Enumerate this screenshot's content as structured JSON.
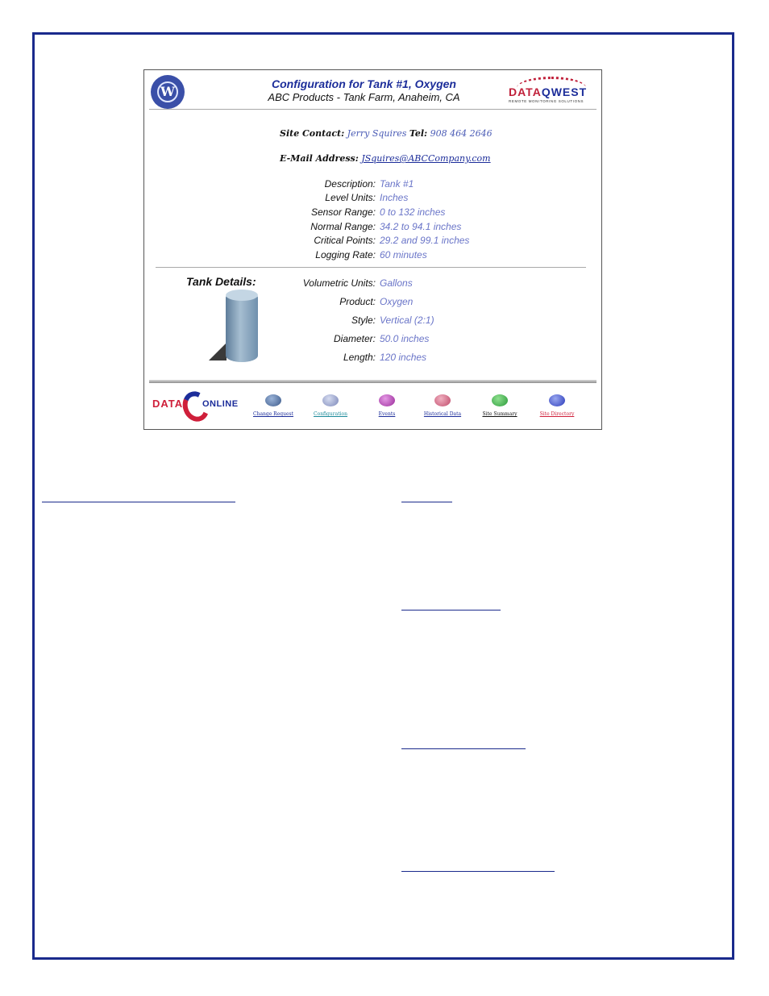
{
  "header": {
    "logo_text": "W",
    "title": "Configuration for Tank #1, Oxygen",
    "subtitle": "ABC Products - Tank Farm, Anaheim, CA",
    "brand_logo": {
      "text_red": "DATA",
      "text_blue": "QWEST",
      "tagline": "REMOTE MONITORING SOLUTIONS"
    }
  },
  "contact": {
    "site_contact_label": "Site Contact:",
    "site_contact_value": "Jerry Squires",
    "tel_label": "Tel:",
    "tel_value": "908 464 2646",
    "email_label": "E-Mail Address:",
    "email_value": "JSquires@ABCCompany.com"
  },
  "config_fields": [
    {
      "label": "Description:",
      "value": "Tank #1"
    },
    {
      "label": "Level Units:",
      "value": "Inches"
    },
    {
      "label": "Sensor Range:",
      "value": "0 to 132 inches"
    },
    {
      "label": "Normal Range:",
      "value": "34.2 to 94.1 inches"
    },
    {
      "label": "Critical Points:",
      "value": "29.2 and 99.1 inches"
    },
    {
      "label": "Logging Rate:",
      "value": "60 minutes"
    }
  ],
  "tank_details": {
    "heading": "Tank Details:",
    "fields": [
      {
        "label": "Volumetric Units:",
        "value": "Gallons"
      },
      {
        "label": "Product:",
        "value": "Oxygen"
      },
      {
        "label": "Style:",
        "value": "Vertical (2:1)"
      },
      {
        "label": "Diameter:",
        "value": "50.0 inches"
      },
      {
        "label": "Length:",
        "value": "120 inches"
      }
    ]
  },
  "nav": {
    "brand": {
      "part1": "DATA",
      "part2": "ONLINE"
    },
    "items": [
      {
        "label": "Change Request",
        "icon": "globe-icon",
        "color": "#3c5a8a",
        "text_color": "#1c2d9a"
      },
      {
        "label": "Configuration",
        "icon": "gear-globe-icon",
        "color": "#7a86b8",
        "text_color": "#1c8a9a"
      },
      {
        "label": "Events",
        "icon": "star-icon",
        "color": "#9a2a9a",
        "text_color": "#1c2d9a"
      },
      {
        "label": "Historical Data",
        "icon": "chart-icon",
        "color": "#c04a6a",
        "text_color": "#1c2d9a"
      },
      {
        "label": "Site Summary",
        "icon": "dollar-icon",
        "color": "#2a9a3a",
        "text_color": "#111111"
      },
      {
        "label": "Site Directory",
        "icon": "directory-icon",
        "color": "#2a3aba",
        "text_color": "#cf1f3a"
      }
    ]
  },
  "colors": {
    "border": "#1a2a8c",
    "accent": "#1c2d9a",
    "value_text": "#6a75c8"
  }
}
